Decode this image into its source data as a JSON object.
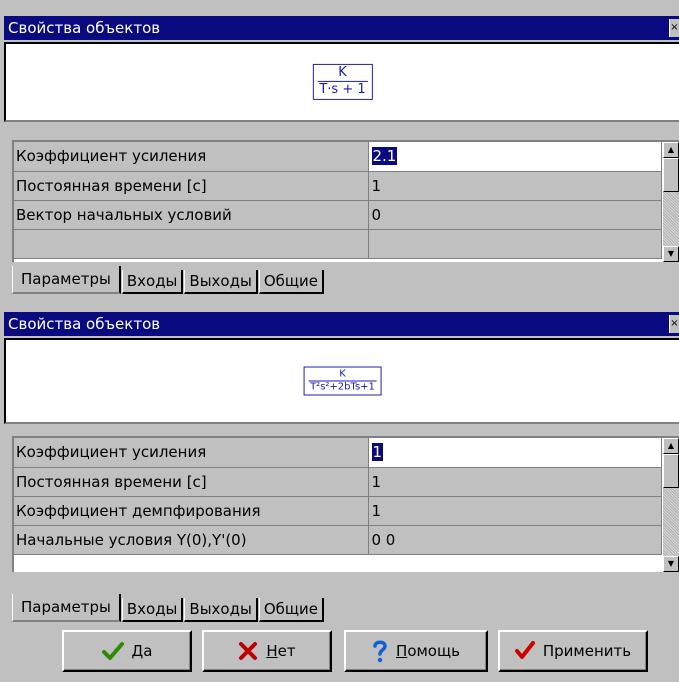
{
  "window_title": "Свойства объектов",
  "panels": [
    {
      "title": "Свойства объектов",
      "formula": {
        "numerator": "K",
        "denominator": "T·s + 1"
      },
      "rows": [
        {
          "name": "Коэффициент усиления",
          "value": "2.1"
        },
        {
          "name": "Постоянная времени [c]",
          "value": "1"
        },
        {
          "name": "Вектор начальных условий",
          "value": "0"
        },
        {
          "name": "",
          "value": ""
        }
      ],
      "tabs": [
        "Параметры",
        "Входы",
        "Выходы",
        "Общие"
      ]
    },
    {
      "title": "Свойства объектов",
      "formula": {
        "numerator": "K",
        "denominator": "T²s²+2bTs+1"
      },
      "rows": [
        {
          "name": "Коэффициент усиления",
          "value": "1"
        },
        {
          "name": "Постоянная времени [c]",
          "value": "1"
        },
        {
          "name": "Коэффициент демпфирования",
          "value": "1"
        },
        {
          "name": "Начальные условия Y(0),Y'(0)",
          "value": "0 0"
        }
      ],
      "tabs": [
        "Параметры",
        "Входы",
        "Выходы",
        "Общие"
      ]
    }
  ],
  "buttons": {
    "ok": {
      "label_underlined": "Д",
      "label_rest": "а",
      "icon": "checkmark-icon",
      "icon_color": "#2e8b00"
    },
    "no": {
      "label_underlined": "Н",
      "label_rest": "ет",
      "icon": "cross-icon",
      "icon_color": "#c00000"
    },
    "help": {
      "label_underlined": "П",
      "label_rest": "омощь",
      "icon": "question-icon",
      "icon_color": "#1060d0"
    },
    "apply": {
      "label": "Применить",
      "icon": "checkmark-icon",
      "icon_color": "#d00000"
    }
  }
}
